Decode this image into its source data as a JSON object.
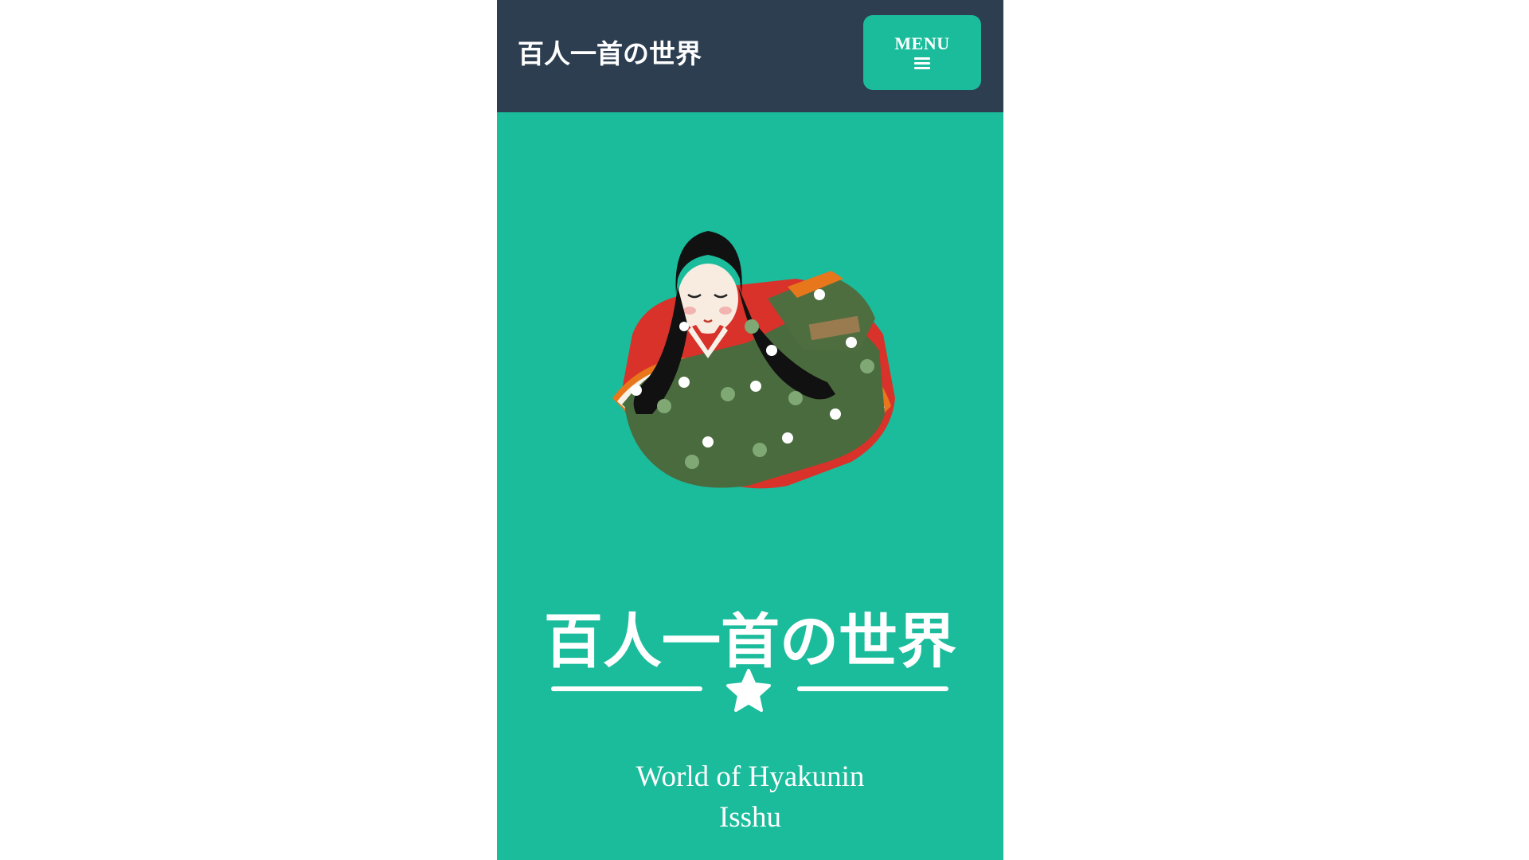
{
  "navbar": {
    "brand": "百人一首の世界",
    "menu_label": "MENU",
    "menu_icon": "hamburger-icon"
  },
  "masthead": {
    "image": "heian-court-lady-illustration",
    "title": "百人一首の世界",
    "divider_icon": "star-icon",
    "subheading_line1": "World of Hyakunin",
    "subheading_line2": "Isshu"
  },
  "colors": {
    "navbar_bg": "#2c3e50",
    "accent": "#1abc9c",
    "text": "#ffffff",
    "page_bg": "#ffffff"
  }
}
